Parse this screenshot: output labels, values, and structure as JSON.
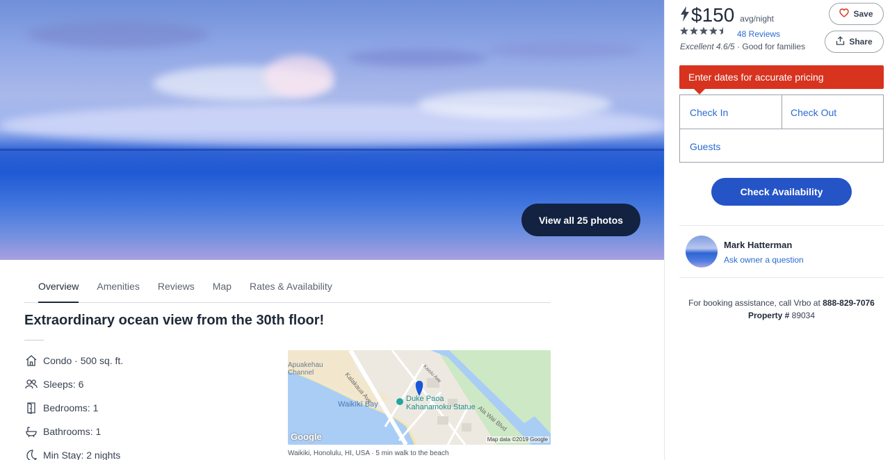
{
  "hero": {
    "photos_button": "View all 25 photos"
  },
  "tabs": [
    {
      "label": "Overview",
      "active": true
    },
    {
      "label": "Amenities"
    },
    {
      "label": "Reviews"
    },
    {
      "label": "Map"
    },
    {
      "label": "Rates & Availability"
    }
  ],
  "listing": {
    "title": "Extraordinary ocean view from the 30th floor!",
    "facts": [
      {
        "icon": "home-icon",
        "label": "Condo · 500 sq. ft."
      },
      {
        "icon": "people-icon",
        "label": "Sleeps: 6"
      },
      {
        "icon": "door-icon",
        "label": "Bedrooms: 1"
      },
      {
        "icon": "bath-icon",
        "label": "Bathrooms: 1"
      },
      {
        "icon": "moon-icon",
        "label": "Min Stay: 2 nights"
      }
    ]
  },
  "map": {
    "labels": {
      "channel": "Apuakehau Channel",
      "kalakaua": "Kalakaua Ave",
      "kaiolu": "Kaiolu Ave",
      "waikiki_bay": "Waikīkī Bay",
      "statue": "Duke Paoa Kahanamoku Statue",
      "ala_wai": "Ala Wai Blvd",
      "google": "Google",
      "attribution": "Map data ©2019 Google"
    },
    "caption": "Waikiki, Honolulu, HI, USA · 5 min walk to the beach"
  },
  "pricing": {
    "price": "$150",
    "per": "avg/night",
    "rating_stars": 4.5,
    "reviews": "48 Reviews",
    "rating_text": "Excellent 4.6/5",
    "tagline": "· Good for families",
    "save": "Save",
    "share": "Share",
    "alert": "Enter dates for accurate pricing",
    "check_in": "Check In",
    "check_out": "Check Out",
    "guests": "Guests",
    "check_button": "Check Availability"
  },
  "owner": {
    "name": "Mark Hatterman",
    "ask": "Ask owner a question"
  },
  "assistance": {
    "prefix": "For booking assistance, call Vrbo at",
    "phone": "888-829-7076",
    "property_label": "Property #",
    "property_number": "89034"
  },
  "colors": {
    "primary_button": "#2554c7",
    "alert": "#d7331f",
    "link": "#2b6bd1",
    "photos_button": "#122240"
  }
}
